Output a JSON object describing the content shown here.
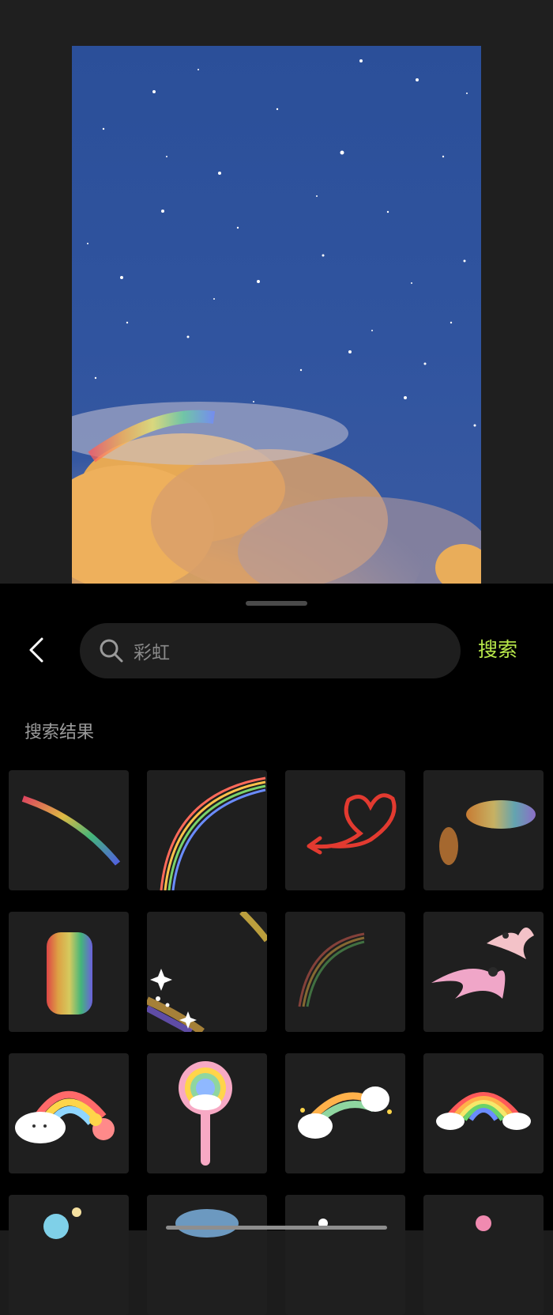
{
  "search": {
    "value": "彩虹",
    "button_label": "搜索"
  },
  "results": {
    "title": "搜索结果",
    "items": [
      {
        "icon": "rainbow-streak-sticker"
      },
      {
        "icon": "rainbow-arc-sticker"
      },
      {
        "icon": "red-heart-arrow-sticker"
      },
      {
        "icon": "rainbow-light-leak-sticker"
      },
      {
        "icon": "rainbow-bar-sticker"
      },
      {
        "icon": "sparkle-rainbow-sticker"
      },
      {
        "icon": "faint-rainbow-arc-sticker"
      },
      {
        "icon": "pink-birds-sticker"
      },
      {
        "icon": "cloud-rainbow-flowers-sticker"
      },
      {
        "icon": "rainbow-lollipop-sticker"
      },
      {
        "icon": "cloud-rainbow-friends-sticker"
      },
      {
        "icon": "rainbow-clouds-sticker"
      },
      {
        "icon": "partial-sticker-1"
      },
      {
        "icon": "partial-sticker-2"
      },
      {
        "icon": "partial-sticker-3"
      },
      {
        "icon": "partial-sticker-4"
      }
    ]
  },
  "colors": {
    "accent": "#b8e84a",
    "sheet_background": "#000000",
    "tile_background": "#1f1f1f",
    "canvas_sky": "#30549f"
  }
}
